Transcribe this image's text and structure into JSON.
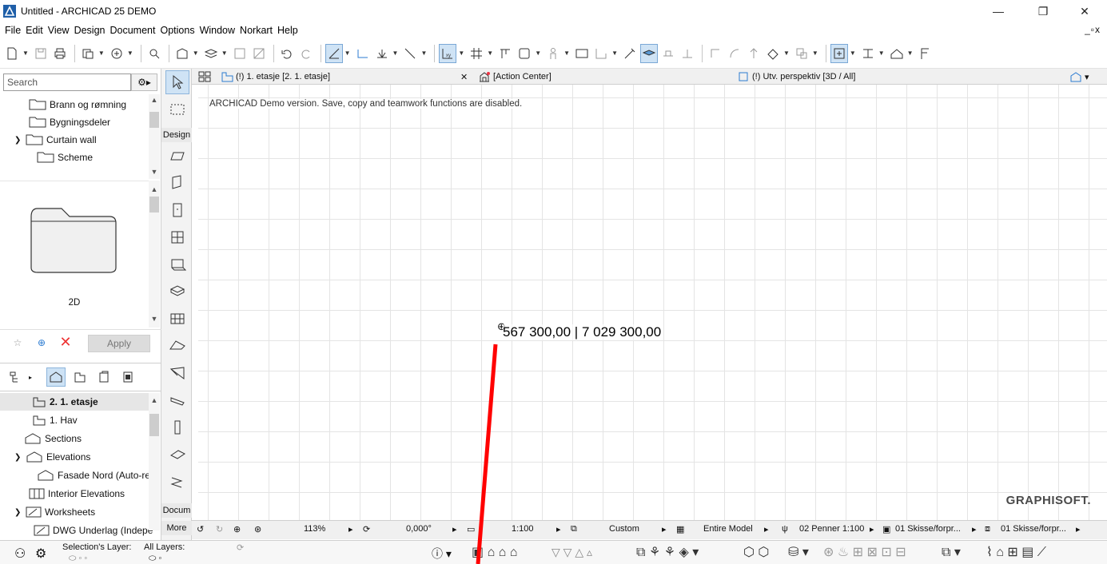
{
  "window": {
    "title": "Untitled - ARCHICAD 25 DEMO",
    "controls": [
      "—",
      "❐",
      "✕"
    ],
    "mdi_controls": "_▫x"
  },
  "menu": [
    "File",
    "Edit",
    "View",
    "Design",
    "Document",
    "Options",
    "Window",
    "Norkart",
    "Help"
  ],
  "navigator": {
    "search_placeholder": "Search",
    "tree_top": [
      {
        "label": "Brann og rømning"
      },
      {
        "label": "Bygningsdeler"
      },
      {
        "label": "Curtain wall"
      },
      {
        "label": "Scheme"
      }
    ],
    "preview_label": "2D",
    "apply_label": "Apply",
    "tree_bottom": [
      {
        "label": "2. 1. etasje"
      },
      {
        "label": "1. Hav"
      },
      {
        "label": "Sections"
      },
      {
        "label": "Elevations"
      },
      {
        "label": "Fasade Nord (Auto-reb"
      },
      {
        "label": "Interior Elevations"
      },
      {
        "label": "Worksheets"
      },
      {
        "label": "DWG Underlag (Indepe"
      }
    ]
  },
  "toolbox": {
    "design_label": "Design",
    "document_label": "Docum",
    "more_label": "More"
  },
  "tabs": [
    {
      "label": "(!) 1. etasje [2. 1. etasje]"
    },
    {
      "label": "[Action Center]"
    },
    {
      "label": "(!) Utv. perspektiv [3D / All]"
    }
  ],
  "canvas": {
    "demo_notice": "ARCHICAD Demo version. Save, copy and teamwork functions are disabled.",
    "coordinates": "567 300,00 | 7 029 300,00",
    "logo": "GRAPHISOFT."
  },
  "viewbar": {
    "zoom": "113%",
    "angle": "0,000°",
    "scale": "1:100",
    "layer_combo": "Custom",
    "model_view": "Entire Model",
    "pen_set": "02 Penner 1:100",
    "override1": "01 Skisse/forpr...",
    "override2": "01 Skisse/forpr..."
  },
  "infobar": {
    "selection_layer_label": "Selection's Layer:",
    "all_layers_label": "All Layers:"
  },
  "colors": {
    "accent_active": "#cfe3f5",
    "red_line": "#ff0000",
    "grid": "#e4e4e4"
  }
}
